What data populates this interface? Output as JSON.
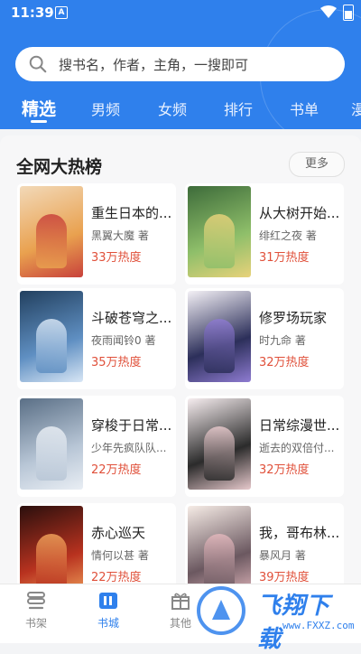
{
  "status_bar": {
    "time": "11:39",
    "notification_glyph": "A"
  },
  "search": {
    "placeholder": "搜书名，作者，主角，一搜即可"
  },
  "tabs": [
    {
      "label": "精选",
      "active": true
    },
    {
      "label": "男频"
    },
    {
      "label": "女频"
    },
    {
      "label": "排行"
    },
    {
      "label": "书单"
    },
    {
      "label": "漫"
    }
  ],
  "section": {
    "title": "全网大热榜",
    "more_label": "更多"
  },
  "books": [
    {
      "title": "重生日本的...",
      "author": "黑翼大魔 著",
      "heat": "33万热度",
      "cover_colors": [
        "#f2d9b8",
        "#e9a14f",
        "#c8413b"
      ]
    },
    {
      "title": "从大树开始...",
      "author": "绯红之夜 著",
      "heat": "31万热度",
      "cover_colors": [
        "#3d6b3a",
        "#8fbf6a",
        "#e8d27a"
      ]
    },
    {
      "title": "斗破苍穹之...",
      "author": "夜雨闻铃0 著",
      "heat": "35万热度",
      "cover_colors": [
        "#22405f",
        "#5f8fc2",
        "#d8e6f5"
      ]
    },
    {
      "title": "修罗场玩家",
      "author": "时九命 著",
      "heat": "32万热度",
      "cover_colors": [
        "#f4f1f6",
        "#2c2f5a",
        "#8e7bd1"
      ]
    },
    {
      "title": "穿梭于日常...",
      "author": "少年先疯队队...",
      "heat": "22万热度",
      "cover_colors": [
        "#5a6f86",
        "#b8c6d6",
        "#e9eef4"
      ]
    },
    {
      "title": "日常综漫世...",
      "author": "逝去的双倍付...",
      "heat": "32万热度",
      "cover_colors": [
        "#f7eef0",
        "#2b2b2b",
        "#e7c9cc"
      ]
    },
    {
      "title": "赤心巡天",
      "author": "情何以甚 著",
      "heat": "22万热度",
      "cover_colors": [
        "#2a0f0d",
        "#b8321f",
        "#f0a15a"
      ]
    },
    {
      "title": "我，哥布林...",
      "author": "暴风月 著",
      "heat": "39万热度",
      "cover_colors": [
        "#f6ece6",
        "#6b5860",
        "#e3b8bd"
      ]
    }
  ],
  "bottom_nav": [
    {
      "label": "书架",
      "icon": "bookshelf-icon"
    },
    {
      "label": "书城",
      "icon": "bookstore-icon",
      "active": true
    },
    {
      "label": "其他",
      "icon": "gift-icon"
    }
  ],
  "watermark": {
    "text": "飞翔下载",
    "url": "www.FXXZ.com"
  },
  "colors": {
    "accent": "#2f80ec",
    "heat": "#e0503a"
  }
}
